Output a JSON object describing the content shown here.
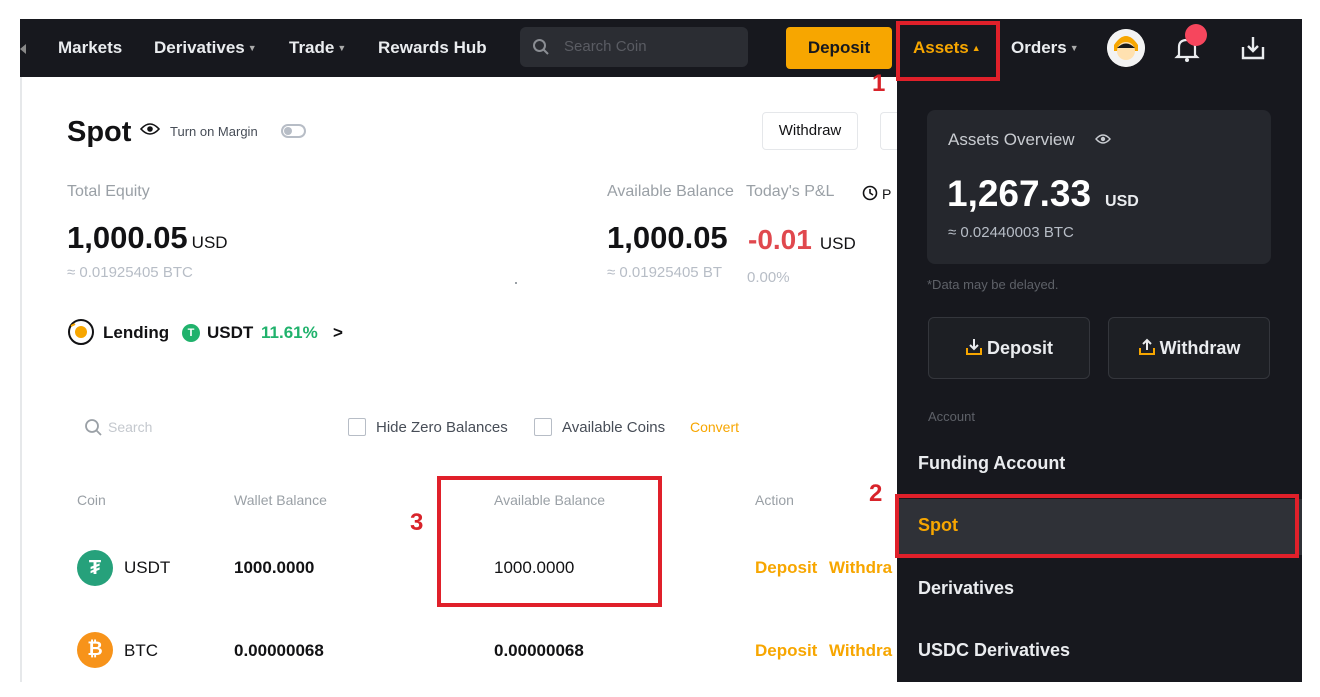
{
  "nav": {
    "markets": "Markets",
    "derivatives": "Derivatives",
    "trade": "Trade",
    "rewards_hub": "Rewards Hub",
    "search_placeholder": "Search Coin",
    "deposit": "Deposit",
    "assets": "Assets",
    "orders": "Orders"
  },
  "annotations": {
    "n1": "1",
    "n2": "2",
    "n3": "3"
  },
  "spot": {
    "title": "Spot",
    "margin_toggle_label": "Turn on Margin",
    "withdraw_label": "Withdraw",
    "total_equity_label": "Total Equity",
    "total_equity_value": "1,000.05",
    "total_equity_unit": "USD",
    "total_equity_btc": "≈ 0.01925405 BTC",
    "available_label": "Available Balance",
    "available_value": "1,000.05",
    "available_btc": "≈ 0.01925405 BT",
    "pnl_label": "Today's P&L",
    "pnl_clock_label": "P",
    "pnl_value": "-0.01",
    "pnl_unit": "USD",
    "pnl_pct": "0.00%",
    "lending_label": "Lending",
    "lending_coin": "USDT",
    "lending_rate": "11.61%",
    "lending_arrow": ">",
    "search_placeholder": "Search",
    "hide_zero_label": "Hide Zero Balances",
    "available_coins_label": "Available Coins",
    "convert_label": "Convert",
    "columns": {
      "coin": "Coin",
      "wallet": "Wallet Balance",
      "available": "Available Balance",
      "action": "Action"
    },
    "rows": [
      {
        "coin": "USDT",
        "wallet": "1000.0000",
        "available": "1000.0000",
        "deposit": "Deposit",
        "withdraw": "Withdra"
      },
      {
        "coin": "BTC",
        "wallet": "0.00000068",
        "available": "0.00000068",
        "deposit": "Deposit",
        "withdraw": "Withdra"
      }
    ]
  },
  "assets_menu": {
    "overview_title": "Assets Overview",
    "overview_value": "1,267.33",
    "overview_unit": "USD",
    "overview_btc": "≈ 0.02440003 BTC",
    "delay_note": "*Data may be delayed.",
    "deposit_label": "Deposit",
    "withdraw_label": "Withdraw",
    "account_header": "Account",
    "items": [
      "Funding Account",
      "Spot",
      "Derivatives",
      "USDC Derivatives"
    ]
  },
  "colors": {
    "accent": "#f7a600",
    "nav_bg": "#17181e",
    "positive": "#20b26c",
    "negative": "#e0484e",
    "annotation": "#e0202a"
  }
}
